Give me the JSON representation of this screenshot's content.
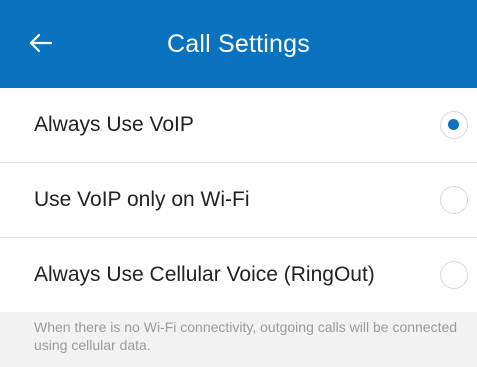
{
  "header": {
    "title": "Call Settings",
    "back_icon": "arrow-left-icon",
    "bg_color": "#0a72bf"
  },
  "options": [
    {
      "label": "Always Use VoIP",
      "selected": true
    },
    {
      "label": "Use VoIP only on Wi-Fi",
      "selected": false
    },
    {
      "label": "Always Use Cellular Voice (RingOut)",
      "selected": false
    }
  ],
  "footnote": "When there is no Wi-Fi connectivity, outgoing calls will be connected using cellular data.",
  "colors": {
    "accent": "#0a72bf",
    "text": "#222222",
    "muted": "#9a9a9a"
  }
}
